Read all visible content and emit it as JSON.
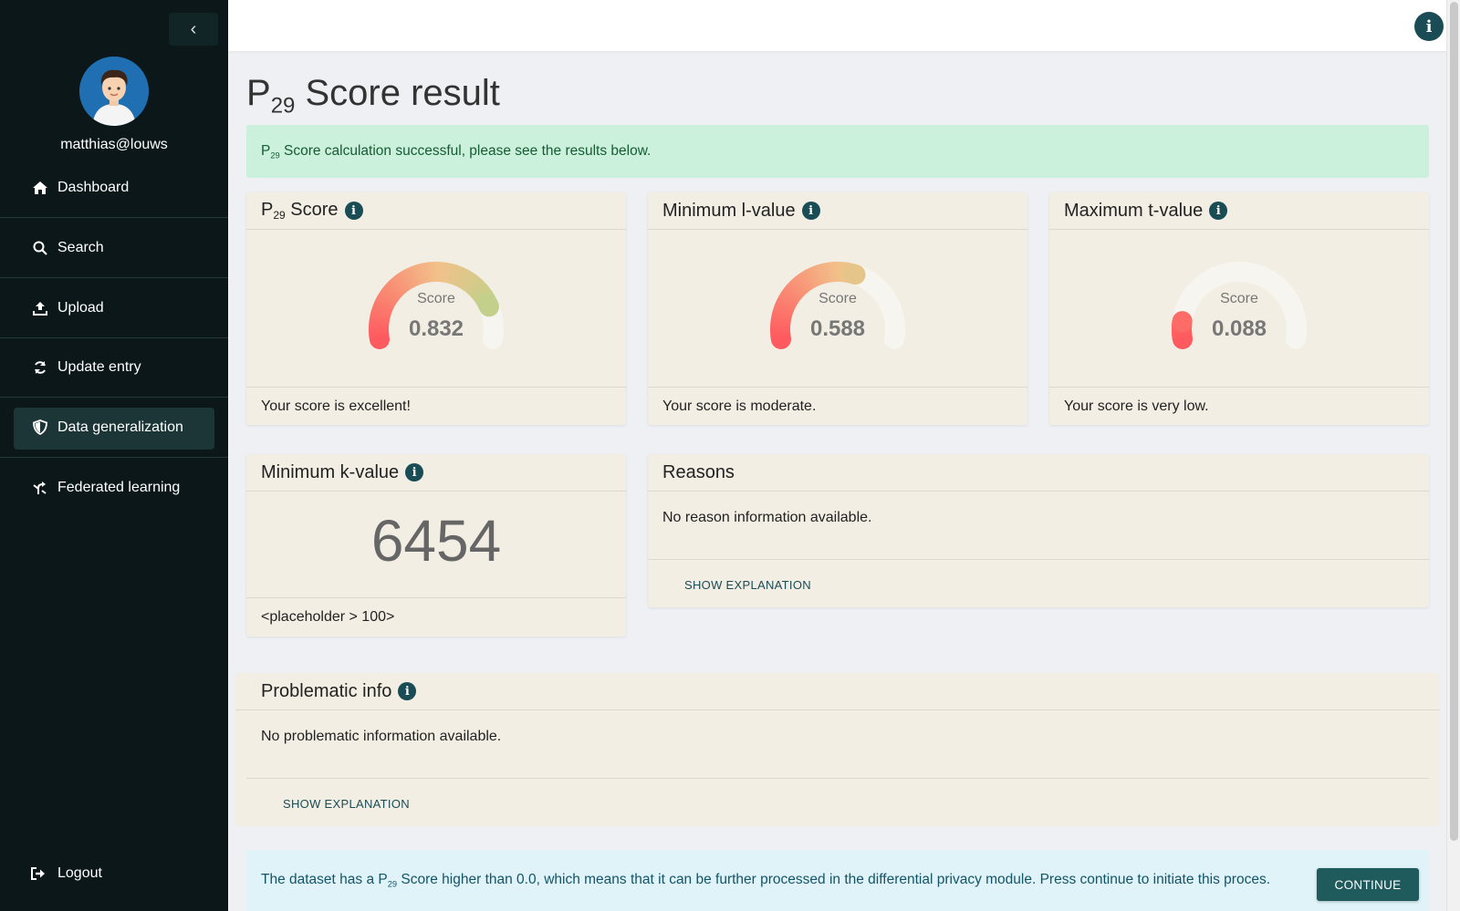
{
  "user": {
    "name": "matthias@louws"
  },
  "sidebar": {
    "collapse_icon": "chevron-left-icon",
    "items": [
      {
        "label": "Dashboard",
        "icon": "home-icon"
      },
      {
        "label": "Search",
        "icon": "search-icon"
      },
      {
        "label": "Upload",
        "icon": "upload-icon"
      },
      {
        "label": "Update entry",
        "icon": "refresh-icon"
      },
      {
        "label": "Data generalization",
        "icon": "shield-icon",
        "active": true
      },
      {
        "label": "Federated learning",
        "icon": "branch-icon"
      }
    ],
    "logout_label": "Logout"
  },
  "page": {
    "title_prefix": "P",
    "title_sub": "29",
    "title_suffix": " Score result"
  },
  "alert_success": {
    "prefix": "P",
    "sub": "29",
    "text": " Score calculation successful, please see the results below."
  },
  "cards": {
    "p29": {
      "title_prefix": "P",
      "title_sub": "29",
      "title_suffix": " Score",
      "score_label": "Score",
      "score": "0.832",
      "value": 0.832,
      "footer": "Your score is excellent!"
    },
    "lvalue": {
      "title": "Minimum l-value",
      "score_label": "Score",
      "score": "0.588",
      "value": 0.588,
      "footer": "Your score is moderate."
    },
    "tvalue": {
      "title": "Maximum t-value",
      "score_label": "Score",
      "score": "0.088",
      "value": 0.088,
      "footer": "Your score is very low."
    },
    "kvalue": {
      "title": "Minimum k-value",
      "number": "6454",
      "footer": "<placeholder > 100>"
    },
    "reasons": {
      "title": "Reasons",
      "body": "No reason information available.",
      "button": "SHOW EXPLANATION"
    },
    "problematic": {
      "title": "Problematic info",
      "body": "No problematic information available.",
      "button": "SHOW EXPLANATION"
    }
  },
  "alert_info": {
    "prefix": "The dataset has a P",
    "sub": "29",
    "text": " Score higher than 0.0, which means that it can be further processed in the differential privacy module. Press continue to initiate this proces.",
    "button": "CONTINUE"
  },
  "colors": {
    "sidebar": "#0b1718",
    "accent": "#1a4c55",
    "card": "#f2eee4",
    "success_bg": "#cbf0dc",
    "info_bg": "#dff3f9",
    "gauge_low": "#ff5a5f",
    "gauge_mid": "#f2c18a",
    "gauge_high": "#a7d98b"
  }
}
